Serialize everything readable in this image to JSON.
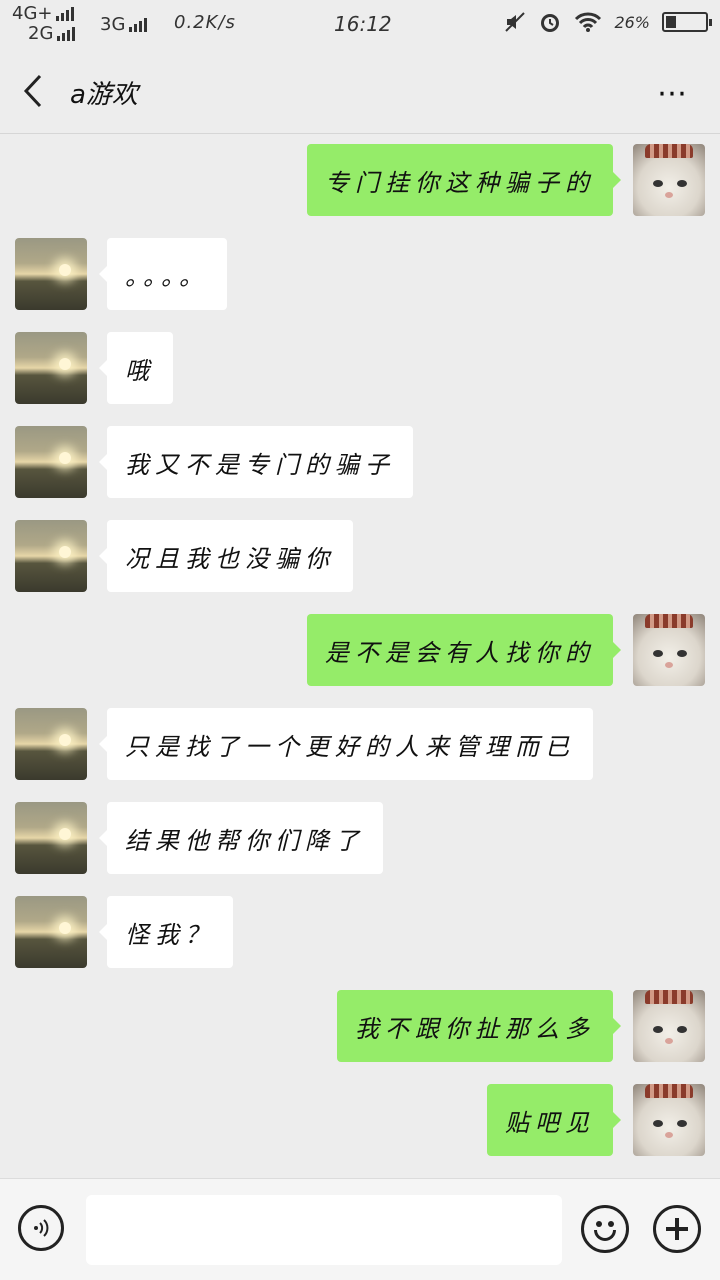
{
  "status_bar": {
    "net1": "4G+",
    "net2": "2G",
    "net3": "3G",
    "speed": "0.2K/s",
    "time": "16:12",
    "battery": "26%",
    "battery_level": 0.26,
    "icons": [
      "mute-icon",
      "alarm-icon",
      "wifi-icon",
      "battery-icon"
    ]
  },
  "header": {
    "title": "a游欢",
    "back_icon": "chevron-left-icon",
    "more_icon": "more-dots-icon"
  },
  "messages": [
    {
      "side": "right",
      "text": "专门挂你这种骗子的"
    },
    {
      "side": "left",
      "text": "。。。。"
    },
    {
      "side": "left",
      "text": "哦"
    },
    {
      "side": "left",
      "text": "我又不是专门的骗子"
    },
    {
      "side": "left",
      "text": "况且我也没骗你"
    },
    {
      "side": "right",
      "text": "是不是会有人找你的"
    },
    {
      "side": "left",
      "text": "只是找了一个更好的人来管理而已"
    },
    {
      "side": "left",
      "text": "结果他帮你们降了"
    },
    {
      "side": "left",
      "text": "怪我？"
    },
    {
      "side": "right",
      "text": "我不跟你扯那么多"
    },
    {
      "side": "right",
      "text": "贴吧见"
    }
  ],
  "input_bar": {
    "voice_icon": "voice-icon",
    "emoji_icon": "emoji-icon",
    "plus_icon": "plus-icon",
    "value": ""
  }
}
